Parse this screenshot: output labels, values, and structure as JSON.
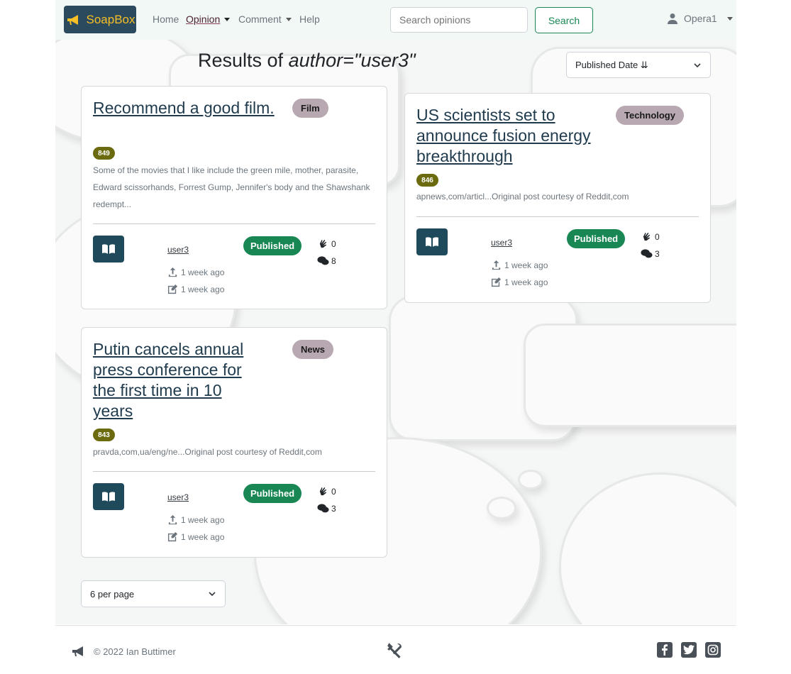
{
  "brand": {
    "name": "SoapBox",
    "icon": "megaphone-icon",
    "color": "#f6bf26",
    "bg": "#2c4a5e"
  },
  "nav": {
    "home": "Home",
    "opinion": "Opinion",
    "comment": "Comment",
    "help": "Help"
  },
  "search": {
    "placeholder": "Search opinions",
    "button": "Search"
  },
  "user": {
    "name": "Opera1",
    "icon": "user-icon"
  },
  "results": {
    "prefix": "Results of ",
    "query": "author=\"user3\"",
    "sort": "Published Date ⇊",
    "per_page": "6 per page"
  },
  "cards": [
    {
      "title": "Recommend a good film.",
      "tag": "Film",
      "id": "849",
      "excerpt": "Some of the movies that I like include the green mile, mother, parasite, Edward scissorhands, Forrest Gump, Jennifer's body and the Shawshank redempt...",
      "author": "user3",
      "status": "Published",
      "published": "1 week ago",
      "updated": "1 week ago",
      "claps": "0",
      "comments": "8"
    },
    {
      "title": "US scientists set to announce fusion energy breakthrough",
      "tag": "Technology",
      "id": "846",
      "excerpt": "apnews,com/articl...Original post courtesy of Reddit,com",
      "author": "user3",
      "status": "Published",
      "published": "1 week ago",
      "updated": "1 week ago",
      "claps": "0",
      "comments": "3"
    },
    {
      "title": "Putin cancels annual press conference for the first time in 10 years",
      "tag": "News",
      "id": "843",
      "excerpt": "pravda,com,ua/eng/ne...Original post courtesy of Reddit,com",
      "author": "user3",
      "status": "Published",
      "published": "1 week ago",
      "updated": "1 week ago",
      "claps": "0",
      "comments": "3"
    }
  ],
  "footer": {
    "copyright": "© 2022 Ian Buttimer",
    "icons": [
      "megaphone-icon",
      "tools-icon",
      "facebook-icon",
      "twitter-icon",
      "instagram-icon"
    ]
  },
  "colors": {
    "published": "#198754",
    "tag": "#b7a8b1",
    "id_badge": "#6b6a0e",
    "read_button": "#1f4a5c",
    "title_link": "#1f3b4d"
  }
}
